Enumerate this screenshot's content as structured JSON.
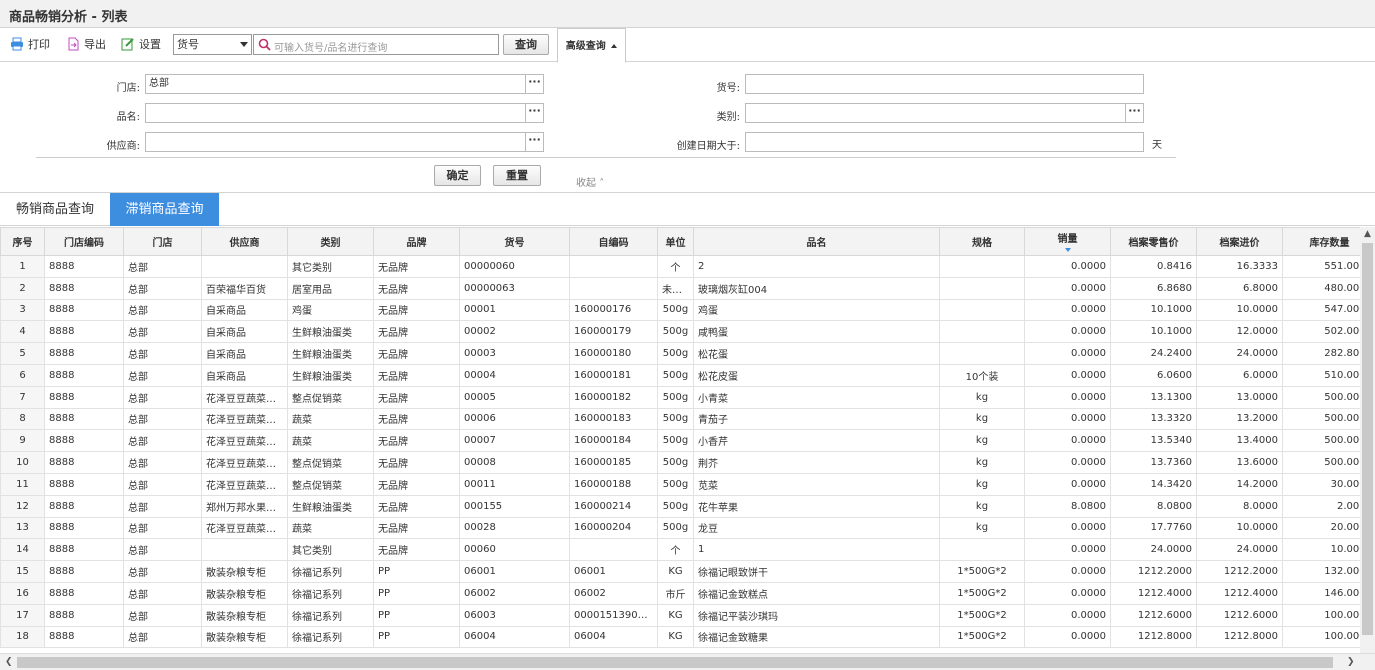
{
  "window": {
    "title": "商品畅销分析 - 列表"
  },
  "toolbar": {
    "print_label": "打印",
    "export_label": "导出",
    "settings_label": "设置",
    "field_select": "货号",
    "search_placeholder": "可输入货号/品名进行查询",
    "query_label": "查询",
    "advanced_label": "高级查询"
  },
  "form": {
    "store_label": "门店:",
    "store_value": "总部",
    "name_label": "品名:",
    "supplier_label": "供应商:",
    "code_label": "货号:",
    "category_label": "类别:",
    "created_label": "创建日期大于:",
    "days_unit": "天",
    "confirm_label": "确定",
    "reset_label": "重置",
    "collapse_label": "收起"
  },
  "tabs": [
    {
      "label": "畅销商品查询"
    },
    {
      "label": "滞销商品查询"
    }
  ],
  "table": {
    "columns": [
      "序号",
      "门店编码",
      "门店",
      "供应商",
      "类别",
      "品牌",
      "货号",
      "自编码",
      "单位",
      "品名",
      "规格",
      "销量",
      "档案零售价",
      "档案进价",
      "库存数量"
    ],
    "rows": [
      [
        "1",
        "8888",
        "总部",
        "",
        "其它类别",
        "无品牌",
        "00000060",
        "",
        "个",
        "2",
        "",
        "0.0000",
        "0.8416",
        "16.3333",
        "551.0000"
      ],
      [
        "2",
        "8888",
        "总部",
        "百荣福华百货",
        "居室用品",
        "无品牌",
        "00000063",
        "",
        "未指定",
        "玻璃烟灰缸004",
        "",
        "0.0000",
        "6.8680",
        "6.8000",
        "480.0000"
      ],
      [
        "3",
        "8888",
        "总部",
        "自采商品",
        "鸡蛋",
        "无品牌",
        "00001",
        "160000176",
        "500g",
        "鸡蛋",
        "",
        "0.0000",
        "10.1000",
        "10.0000",
        "547.0000"
      ],
      [
        "4",
        "8888",
        "总部",
        "自采商品",
        "生鲜粮油蛋类",
        "无品牌",
        "00002",
        "160000179",
        "500g",
        "咸鸭蛋",
        "",
        "0.0000",
        "10.1000",
        "12.0000",
        "502.0000"
      ],
      [
        "5",
        "8888",
        "总部",
        "自采商品",
        "生鲜粮油蛋类",
        "无品牌",
        "00003",
        "160000180",
        "500g",
        "松花蛋",
        "",
        "0.0000",
        "24.2400",
        "24.0000",
        "282.8000"
      ],
      [
        "6",
        "8888",
        "总部",
        "自采商品",
        "生鲜粮油蛋类",
        "无品牌",
        "00004",
        "160000181",
        "500g",
        "松花皮蛋",
        "10个装",
        "0.0000",
        "6.0600",
        "6.0000",
        "510.0000"
      ],
      [
        "7",
        "8888",
        "总部",
        "花泽豆豆蔬菜批发",
        "整点促销菜",
        "无品牌",
        "00005",
        "160000182",
        "500g",
        "小青菜",
        "kg",
        "0.0000",
        "13.1300",
        "13.0000",
        "500.0000"
      ],
      [
        "8",
        "8888",
        "总部",
        "花泽豆豆蔬菜批发",
        "蔬菜",
        "无品牌",
        "00006",
        "160000183",
        "500g",
        "青茄子",
        "kg",
        "0.0000",
        "13.3320",
        "13.2000",
        "500.0000"
      ],
      [
        "9",
        "8888",
        "总部",
        "花泽豆豆蔬菜批发",
        "蔬菜",
        "无品牌",
        "00007",
        "160000184",
        "500g",
        "小香芹",
        "kg",
        "0.0000",
        "13.5340",
        "13.4000",
        "500.0000"
      ],
      [
        "10",
        "8888",
        "总部",
        "花泽豆豆蔬菜批发",
        "整点促销菜",
        "无品牌",
        "00008",
        "160000185",
        "500g",
        "荆芥",
        "kg",
        "0.0000",
        "13.7360",
        "13.6000",
        "500.0000"
      ],
      [
        "11",
        "8888",
        "总部",
        "花泽豆豆蔬菜批发",
        "整点促销菜",
        "无品牌",
        "00011",
        "160000188",
        "500g",
        "苋菜",
        "kg",
        "0.0000",
        "14.3420",
        "14.2000",
        "30.0000"
      ],
      [
        "12",
        "8888",
        "总部",
        "郑州万邦水果蔬菜...",
        "生鲜粮油蛋类",
        "无品牌",
        "000155",
        "160000214",
        "500g",
        "花牛苹果",
        "kg",
        "8.0800",
        "8.0800",
        "8.0000",
        "2.0000"
      ],
      [
        "13",
        "8888",
        "总部",
        "花泽豆豆蔬菜批发",
        "蔬菜",
        "无品牌",
        "00028",
        "160000204",
        "500g",
        "龙豆",
        "kg",
        "0.0000",
        "17.7760",
        "10.0000",
        "20.0000"
      ],
      [
        "14",
        "8888",
        "总部",
        "",
        "其它类别",
        "无品牌",
        "00060",
        "",
        "个",
        "1",
        "",
        "0.0000",
        "24.0000",
        "24.0000",
        "10.0000"
      ],
      [
        "15",
        "8888",
        "总部",
        "散装杂粮专柜",
        "徐福记系列",
        "PP",
        "06001",
        "06001",
        "KG",
        "徐福记眼致饼干",
        "1*500G*2",
        "0.0000",
        "1212.2000",
        "1212.2000",
        "132.0000"
      ],
      [
        "16",
        "8888",
        "总部",
        "散装杂粮专柜",
        "徐福记系列",
        "PP",
        "06002",
        "06002",
        "市斤",
        "徐福记金致糕点",
        "1*500G*2",
        "0.0000",
        "1212.4000",
        "1212.4000",
        "146.0000"
      ],
      [
        "17",
        "8888",
        "总部",
        "散装杂粮专柜",
        "徐福记系列",
        "PP",
        "06003",
        "000015139052...",
        "KG",
        "徐福记平装沙琪玛",
        "1*500G*2",
        "0.0000",
        "1212.6000",
        "1212.6000",
        "100.0000"
      ],
      [
        "18",
        "8888",
        "总部",
        "散装杂粮专柜",
        "徐福记系列",
        "PP",
        "06004",
        "06004",
        "KG",
        "徐福记金致糖果",
        "1*500G*2",
        "0.0000",
        "1212.8000",
        "1212.8000",
        "100.0000"
      ]
    ]
  },
  "colors": {
    "accent": "#3e8ee0"
  },
  "icons": [
    "printer-icon",
    "export-icon",
    "settings-icon",
    "search-icon",
    "ellipsis-icon",
    "chevron-up-icon",
    "sort-desc-icon"
  ]
}
